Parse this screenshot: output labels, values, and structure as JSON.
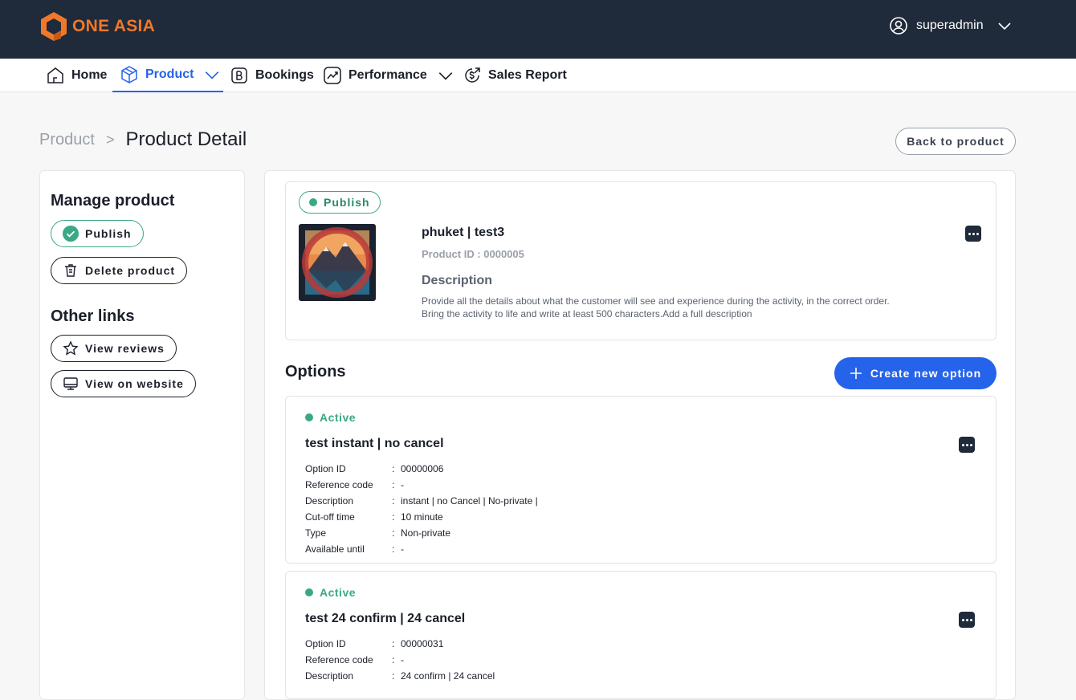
{
  "brand": {
    "name": "ONE ASIA",
    "accent": "#f0782a"
  },
  "user": {
    "name": "superadmin"
  },
  "nav": {
    "items": [
      {
        "label": "Home",
        "icon": "home-icon"
      },
      {
        "label": "Product",
        "icon": "box-icon",
        "active": true
      },
      {
        "label": "Bookings",
        "icon": "bookings-icon"
      },
      {
        "label": "Performance",
        "icon": "chart-icon"
      },
      {
        "label": "Sales Report",
        "icon": "dollar-report-icon"
      }
    ]
  },
  "breadcrumb": {
    "parent": "Product",
    "separator": ">",
    "current": "Product Detail"
  },
  "back_button": "Back to product",
  "sidebar": {
    "manage_title": "Manage product",
    "publish_label": "Publish",
    "delete_label": "Delete product",
    "links_title": "Other links",
    "reviews_label": "View reviews",
    "website_label": "View on website"
  },
  "product": {
    "status": "Publish",
    "title": "phuket | test3",
    "id_text": "Product ID : 0000005",
    "description_heading": "Description",
    "description_line1": "Provide all the details about what the customer will see and experience during the activity, in the correct order.",
    "description_line2": "Bring the activity to life and write at least 500 characters.Add a full description"
  },
  "options": {
    "title": "Options",
    "create_label": "Create new option",
    "list": [
      {
        "status": "Active",
        "title": "test instant | no cancel",
        "rows": [
          {
            "key": "Option ID",
            "value": "00000006"
          },
          {
            "key": "Reference code",
            "value": "-"
          },
          {
            "key": "Description",
            "value": "instant | no Cancel | No-private |"
          },
          {
            "key": "Cut-off time",
            "value": "10 minute"
          },
          {
            "key": "Type",
            "value": "Non-private"
          },
          {
            "key": "Available until",
            "value": "-"
          }
        ]
      },
      {
        "status": "Active",
        "title": "test 24 confirm | 24 cancel",
        "rows": [
          {
            "key": "Option ID",
            "value": "00000031"
          },
          {
            "key": "Reference code",
            "value": "-"
          },
          {
            "key": "Description",
            "value": "24 confirm | 24 cancel"
          }
        ]
      }
    ]
  },
  "colors": {
    "topbar": "#1f2a3a",
    "primary": "#2563eb",
    "success": "#3aa886"
  }
}
